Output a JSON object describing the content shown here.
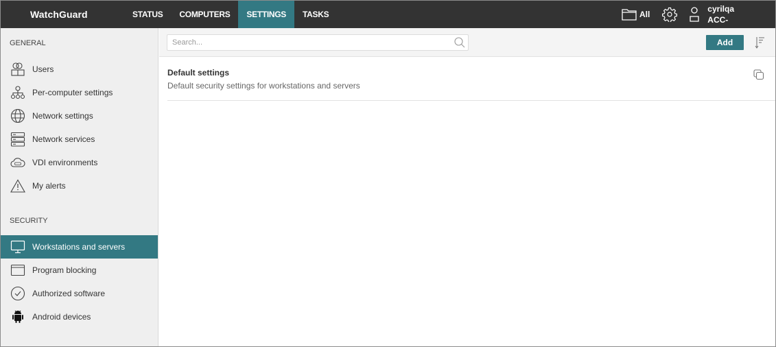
{
  "app": {
    "logo": "WatchGuard"
  },
  "nav": {
    "items": [
      {
        "label": "STATUS",
        "active": false
      },
      {
        "label": "COMPUTERS",
        "active": false
      },
      {
        "label": "SETTINGS",
        "active": true
      },
      {
        "label": "TASKS",
        "active": false
      }
    ]
  },
  "topright": {
    "folder_label": "All",
    "user_name": "cyrilqa",
    "account": "ACC-"
  },
  "sidebar": {
    "general_title": "GENERAL",
    "general_items": [
      {
        "label": "Users",
        "icon": "users-icon"
      },
      {
        "label": "Per-computer settings",
        "icon": "hierarchy-icon"
      },
      {
        "label": "Network settings",
        "icon": "globe-icon"
      },
      {
        "label": "Network services",
        "icon": "server-icon"
      },
      {
        "label": "VDI environments",
        "icon": "vdi-cloud-icon"
      },
      {
        "label": "My alerts",
        "icon": "warning-icon"
      }
    ],
    "security_title": "SECURITY",
    "security_items": [
      {
        "label": "Workstations and servers",
        "icon": "monitor-icon",
        "active": true
      },
      {
        "label": "Program blocking",
        "icon": "window-icon",
        "active": false
      },
      {
        "label": "Authorized software",
        "icon": "check-circle-icon",
        "active": false
      },
      {
        "label": "Android devices",
        "icon": "android-icon",
        "active": false
      }
    ]
  },
  "toolbar": {
    "search_placeholder": "Search...",
    "search_value": "",
    "add_label": "Add"
  },
  "list": {
    "rows": [
      {
        "title": "Default settings",
        "description": "Default security settings for workstations and servers"
      }
    ]
  },
  "colors": {
    "accent": "#337983",
    "topbar": "#333333",
    "sidebar": "#efefef"
  }
}
